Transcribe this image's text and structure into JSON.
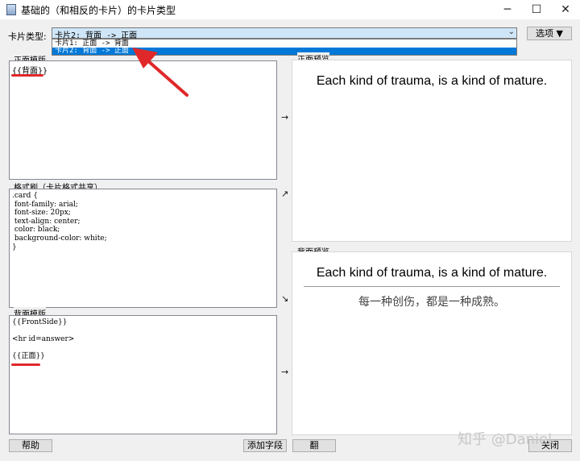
{
  "window": {
    "title": "基础的（和相反的卡片）的卡片类型",
    "minimize_glyph": "─",
    "maximize_glyph": "☐",
    "close_glyph": "✕"
  },
  "toolbar": {
    "card_type_label": "卡片类型:",
    "card_type_value": "卡片2: 背面 -> 正面",
    "chevron_glyph": "⌄",
    "options_label": "选项 ▼"
  },
  "dropdown": {
    "items": [
      {
        "label": "卡片1: 正面 -> 背面"
      },
      {
        "label": "卡片2: 背面 -> 正面"
      }
    ]
  },
  "editor": {
    "front_template_label": "正面模版",
    "front_template_code": "{{背面}}",
    "css_label": "格式刷（卡片格式共享）",
    "css_code": ".card {\n font-family: arial;\n font-size: 20px;\n text-align: center;\n color: black;\n background-color: white;\n}",
    "back_template_label": "背面模版",
    "back_template_code": "{{FrontSide}}\n\n<hr id=answer>\n\n{{正面}}"
  },
  "arrows": {
    "front": "→",
    "css": "↗",
    "css_down": "↘",
    "back": "→"
  },
  "preview": {
    "front_label": "正面预览",
    "front_text": "Each kind of trauma, is a kind of mature.",
    "back_label": "背面预览",
    "back_question": "Each kind of trauma, is a kind of mature.",
    "back_answer": "每一种创伤，都是一种成熟。"
  },
  "buttons": {
    "help": "帮助",
    "add_field": "添加字段",
    "flip": "翻",
    "close": "关闭"
  },
  "watermark": "知乎 @Daniel",
  "colors": {
    "selection": "#0078d7",
    "annotation_red": "#e0282a"
  }
}
